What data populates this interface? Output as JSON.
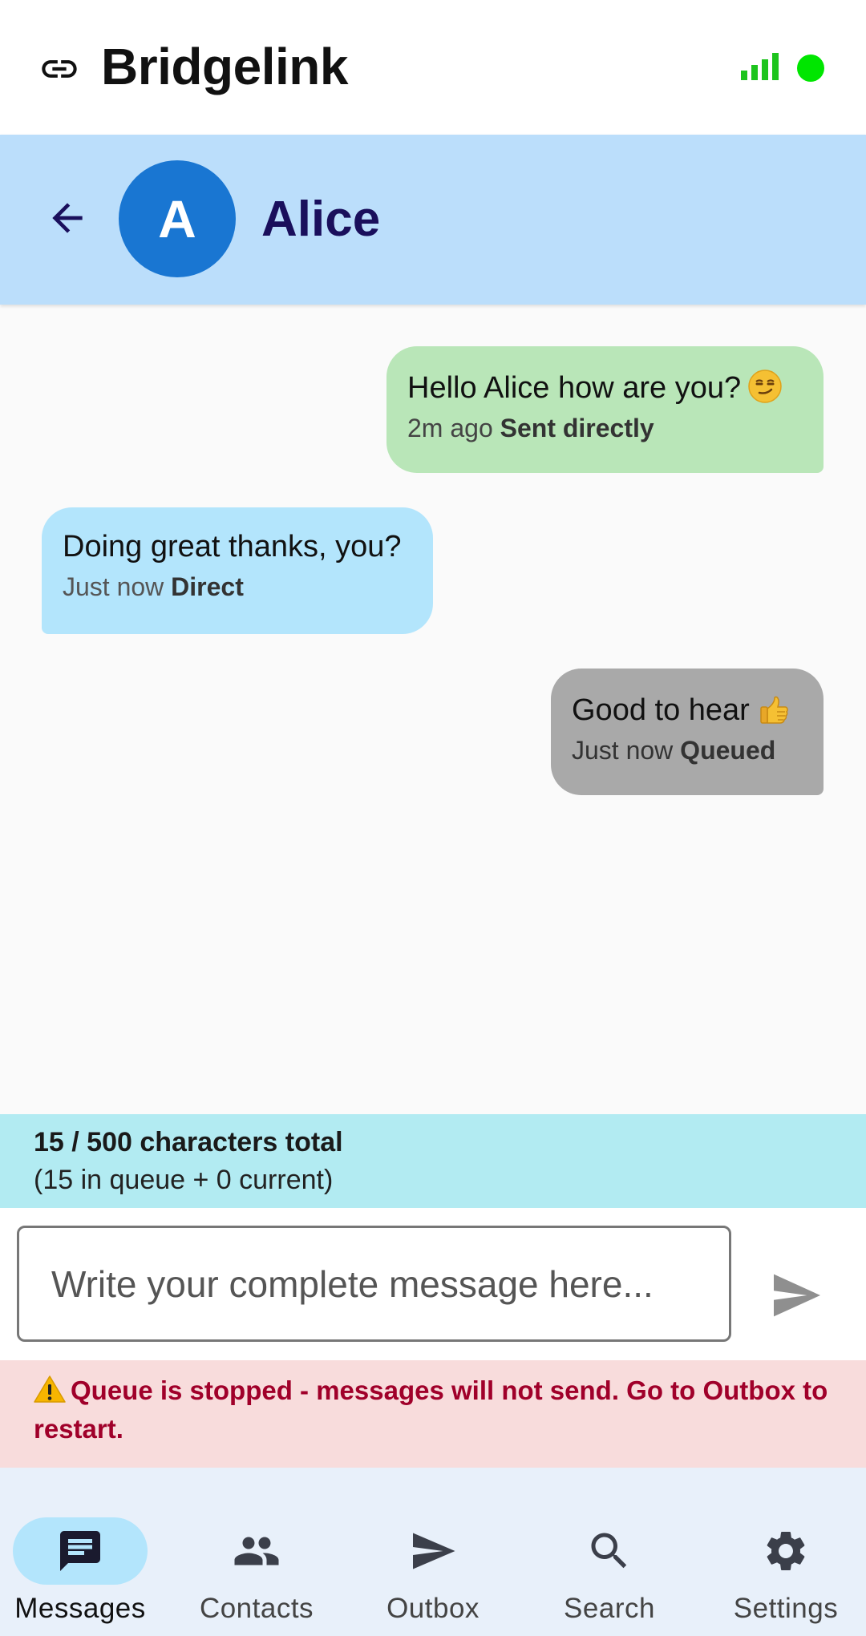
{
  "app": {
    "title": "Bridgelink",
    "logo_icon": "link-icon",
    "signal_icon": "signal-strength-icon",
    "status_color": "#00e600"
  },
  "chat_header": {
    "back_icon": "arrow-back-icon",
    "avatar_letter": "A",
    "avatar_color": "#1976d2",
    "contact_name": "Alice"
  },
  "messages": [
    {
      "direction": "outgoing",
      "text": "Hello Alice how are you?",
      "emoji": "smirking-face-emoji",
      "time": "2m ago",
      "status": "Sent directly",
      "color": "#b9e6b8"
    },
    {
      "direction": "incoming",
      "text": "Doing great thanks, you?",
      "time": "Just now",
      "status": "Direct",
      "color": "#b3e5fc"
    },
    {
      "direction": "outgoing",
      "text": "Good to hear",
      "emoji": "thumbs-up-emoji",
      "time": "Just now",
      "status": "Queued",
      "color": "#a9a9a9"
    }
  ],
  "char_counter": {
    "total": "15 / 500 characters total",
    "breakdown": "(15 in queue + 0 current)"
  },
  "composer": {
    "placeholder": "Write your complete message here...",
    "value": "",
    "send_icon": "send-icon"
  },
  "queue_warning": {
    "icon": "warning-icon",
    "text": "Queue is stopped - messages will not send. Go to Outbox to restart."
  },
  "bottom_nav": {
    "items": [
      {
        "label": "Messages",
        "icon": "chat-icon",
        "active": true
      },
      {
        "label": "Contacts",
        "icon": "people-icon",
        "active": false
      },
      {
        "label": "Outbox",
        "icon": "send-icon",
        "active": false
      },
      {
        "label": "Search",
        "icon": "search-icon",
        "active": false
      },
      {
        "label": "Settings",
        "icon": "gear-icon",
        "active": false
      }
    ]
  }
}
